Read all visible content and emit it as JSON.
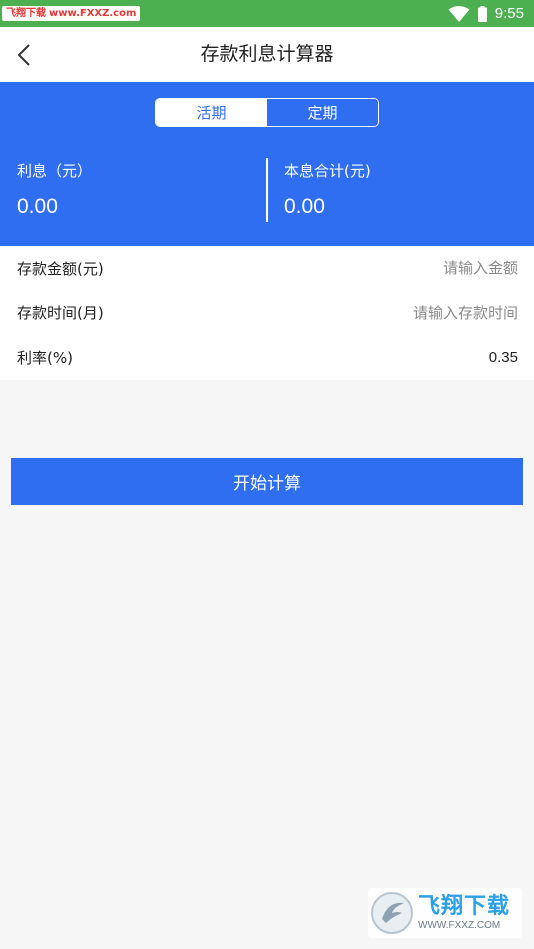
{
  "status_bar": {
    "watermark_cn": "飞翔下载",
    "watermark_url": "www.FXXZ.com",
    "time": "9:55",
    "wifi_icon": "wifi-icon",
    "battery_icon": "battery-icon"
  },
  "nav": {
    "back_icon": "chevron-left-icon",
    "title": "存款利息计算器"
  },
  "tabs": {
    "current": "活期",
    "fixed": "定期",
    "selected": "活期"
  },
  "results": {
    "interest_label": "利息（元）",
    "interest_value": "0.00",
    "total_label": "本息合计(元)",
    "total_value": "0.00"
  },
  "form": {
    "amount_label": "存款金额(元)",
    "amount_placeholder": "请输入金额",
    "amount_value": "",
    "time_label": "存款时间(月)",
    "time_placeholder": "请输入存款时间",
    "time_value": "",
    "rate_label": "利率(%)",
    "rate_value": "0.35"
  },
  "calc_button_label": "开始计算",
  "watermark_bottom": {
    "brand": "飞翔下载",
    "url": "WWW.FXXZ.COM"
  },
  "colors": {
    "primary": "#2f6ef0",
    "status_bar": "#4caf50",
    "background": "#f6f6f6"
  }
}
